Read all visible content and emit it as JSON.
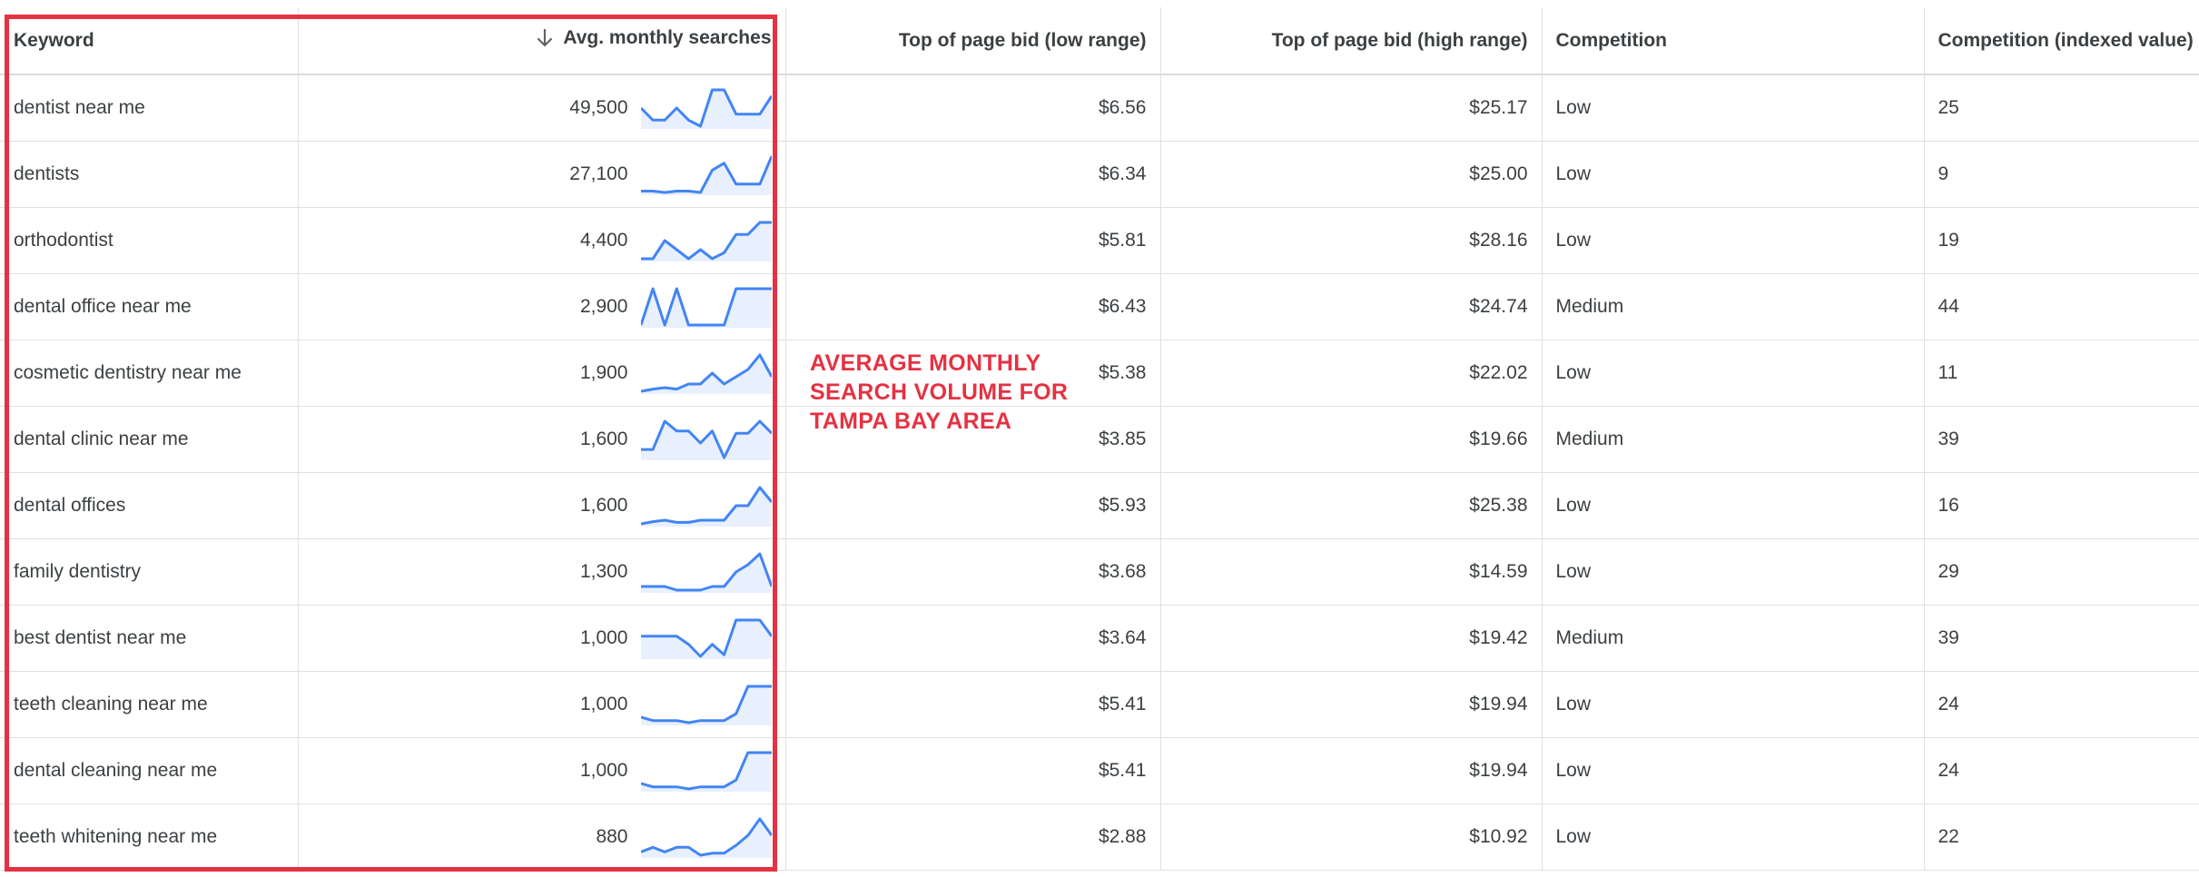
{
  "table": {
    "headers": {
      "keyword": "Keyword",
      "avg_monthly_searches": "Avg. monthly searches",
      "bid_low": "Top of page bid (low range)",
      "bid_high": "Top of page bid (high range)",
      "competition": "Competition",
      "competition_index": "Competition (indexed value)"
    },
    "sort_icon": "arrow-down-icon",
    "rows": [
      {
        "keyword": "dentist near me",
        "searches": "49,500",
        "trend": [
          2,
          0,
          0,
          2,
          0,
          -1,
          5,
          5,
          1,
          1,
          1,
          4
        ],
        "bid_low": "$6.56",
        "bid_high": "$25.17",
        "competition": "Low",
        "index": "25"
      },
      {
        "keyword": "dentists",
        "searches": "27,100",
        "trend": [
          0,
          0,
          -0.2,
          0,
          0,
          -0.2,
          3,
          4,
          1,
          1,
          1,
          5
        ],
        "bid_low": "$6.34",
        "bid_high": "$25.00",
        "competition": "Low",
        "index": "9"
      },
      {
        "keyword": "orthodontist",
        "searches": "4,400",
        "trend": [
          0,
          0,
          3,
          1.5,
          0,
          1.5,
          0,
          1,
          4,
          4,
          6,
          6
        ],
        "bid_low": "$5.81",
        "bid_high": "$28.16",
        "competition": "Low",
        "index": "19"
      },
      {
        "keyword": "dental office near me",
        "searches": "2,900",
        "trend": [
          0,
          6,
          0,
          6,
          0,
          0,
          0,
          0,
          6,
          6,
          6,
          6
        ],
        "bid_low": "$6.43",
        "bid_high": "$24.74",
        "competition": "Medium",
        "index": "44"
      },
      {
        "keyword": "cosmetic dentistry near me",
        "searches": "1,900",
        "trend": [
          0,
          0.3,
          0.5,
          0.3,
          1,
          1,
          2.5,
          1,
          2,
          3,
          5,
          2
        ],
        "bid_low": "$5.38",
        "bid_high": "$22.02",
        "competition": "Low",
        "index": "11"
      },
      {
        "keyword": "dental clinic near me",
        "searches": "1,600",
        "trend": [
          1,
          1,
          4.5,
          3.3,
          3.3,
          1.8,
          3.3,
          0,
          3,
          3,
          4.5,
          3
        ],
        "bid_low": "$3.85",
        "bid_high": "$19.66",
        "competition": "Medium",
        "index": "39"
      },
      {
        "keyword": "dental offices",
        "searches": "1,600",
        "trend": [
          0,
          0.3,
          0.5,
          0.2,
          0.2,
          0.5,
          0.5,
          0.5,
          2.5,
          2.5,
          5,
          3
        ],
        "bid_low": "$5.93",
        "bid_high": "$25.38",
        "competition": "Low",
        "index": "16"
      },
      {
        "keyword": "family dentistry",
        "searches": "1,300",
        "trend": [
          0.5,
          0.5,
          0.5,
          0,
          0,
          0,
          0.5,
          0.5,
          2.5,
          3.5,
          5,
          0.5
        ],
        "bid_low": "$3.68",
        "bid_high": "$14.59",
        "competition": "Low",
        "index": "29"
      },
      {
        "keyword": "best dentist near me",
        "searches": "1,000",
        "trend": [
          2,
          2,
          2,
          2,
          1,
          -0.5,
          1,
          -0.3,
          4,
          4,
          4,
          2
        ],
        "bid_low": "$3.64",
        "bid_high": "$19.42",
        "competition": "Medium",
        "index": "39"
      },
      {
        "keyword": "teeth cleaning near me",
        "searches": "1,000",
        "trend": [
          0.5,
          0,
          0,
          0,
          -0.3,
          0,
          0,
          0,
          1,
          5,
          5,
          5
        ],
        "bid_low": "$5.41",
        "bid_high": "$19.94",
        "competition": "Low",
        "index": "24"
      },
      {
        "keyword": "dental cleaning near me",
        "searches": "1,000",
        "trend": [
          0.5,
          0,
          0,
          0,
          -0.3,
          0,
          0,
          0,
          1,
          5,
          5,
          5
        ],
        "bid_low": "$5.41",
        "bid_high": "$19.94",
        "competition": "Low",
        "index": "24"
      },
      {
        "keyword": "teeth whitening near me",
        "searches": "880",
        "trend": [
          0.5,
          1.2,
          0.5,
          1.2,
          1.2,
          0,
          0.3,
          0.3,
          1.5,
          3,
          5.5,
          3
        ],
        "bid_low": "$2.88",
        "bid_high": "$10.92",
        "competition": "Low",
        "index": "22"
      }
    ]
  },
  "annotation": {
    "lines": [
      "AVERAGE MONTHLY",
      "SEARCH VOLUME FOR",
      "TAMPA BAY AREA"
    ]
  },
  "colors": {
    "spark_line": "#4285f4",
    "spark_fill": "#e8f0fe",
    "highlight": "#e53242"
  }
}
